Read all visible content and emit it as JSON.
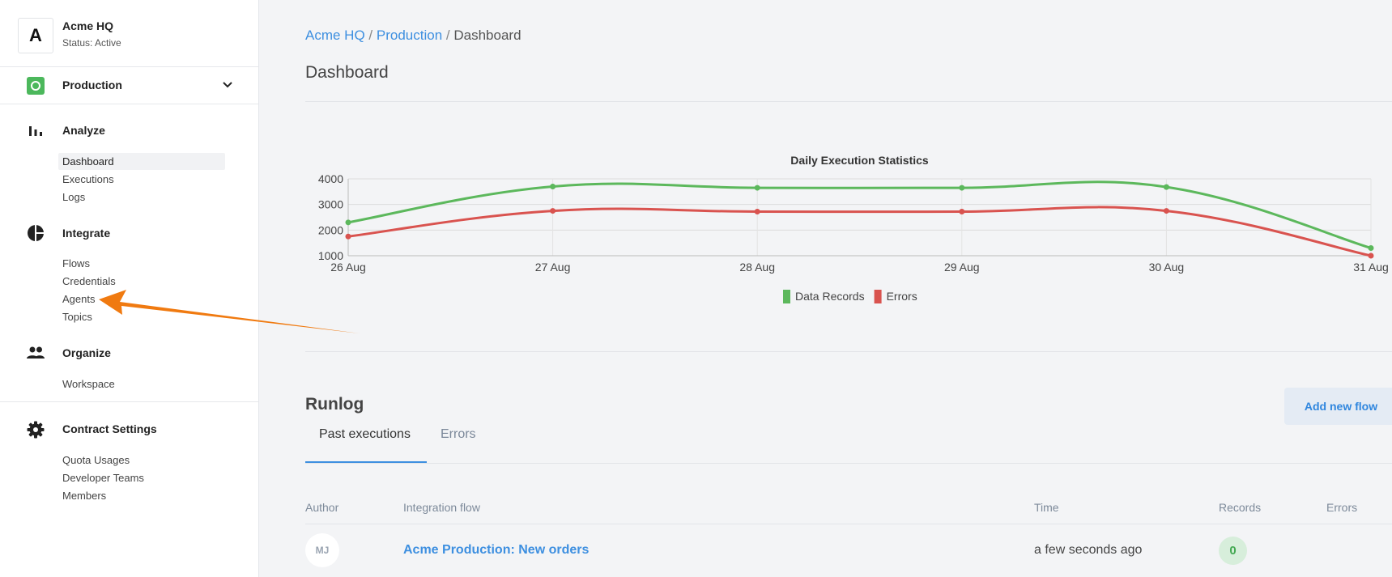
{
  "org": {
    "avatar_letter": "A",
    "name": "Acme HQ",
    "status": "Status: Active"
  },
  "workspace": {
    "name": "Production",
    "icon": "workspace-icon",
    "chevron_icon": "chevron-down-icon"
  },
  "sidebar": {
    "sections": [
      {
        "title": "Analyze",
        "icon": "bar-chart-icon",
        "items": [
          "Dashboard",
          "Executions",
          "Logs"
        ]
      },
      {
        "title": "Integrate",
        "icon": "pie-chart-icon",
        "items": [
          "Flows",
          "Credentials",
          "Agents",
          "Topics"
        ]
      },
      {
        "title": "Organize",
        "icon": "people-icon",
        "items": [
          "Workspace"
        ]
      },
      {
        "title": "Contract Settings",
        "icon": "gear-icon",
        "items": [
          "Quota Usages",
          "Developer Teams",
          "Members"
        ]
      }
    ],
    "active_item": "Dashboard"
  },
  "breadcrumb": {
    "items": [
      "Acme HQ",
      "Production",
      "Dashboard"
    ],
    "separator": "/"
  },
  "page_title": "Dashboard",
  "chart_data": {
    "type": "line",
    "title": "Daily Execution Statistics",
    "categories": [
      "26 Aug",
      "27 Aug",
      "28 Aug",
      "29 Aug",
      "30 Aug",
      "31 Aug"
    ],
    "yticks": [
      1000,
      2000,
      3000,
      4000
    ],
    "ylim": [
      1000,
      4000
    ],
    "series": [
      {
        "name": "Data Records",
        "color": "#5cb85c",
        "values": [
          2300,
          3700,
          3650,
          3650,
          3680,
          1300
        ]
      },
      {
        "name": "Errors",
        "color": "#d9534f",
        "values": [
          1750,
          2750,
          2720,
          2720,
          2750,
          1000
        ]
      }
    ],
    "grid": true,
    "legend": "bottom-center"
  },
  "runlog": {
    "title": "Runlog",
    "tabs": [
      "Past executions",
      "Errors"
    ],
    "active_tab": "Past executions",
    "add_button": "Add new flow",
    "columns": [
      "Author",
      "Integration flow",
      "Time",
      "Records",
      "Errors"
    ],
    "rows": [
      {
        "author_initials": "MJ",
        "flow": "Acme Production: New orders",
        "time": "a few seconds ago",
        "records": "0",
        "errors": ""
      }
    ]
  },
  "annotation": {
    "type": "arrow",
    "color": "#f07a10",
    "points_to": "Agents"
  }
}
